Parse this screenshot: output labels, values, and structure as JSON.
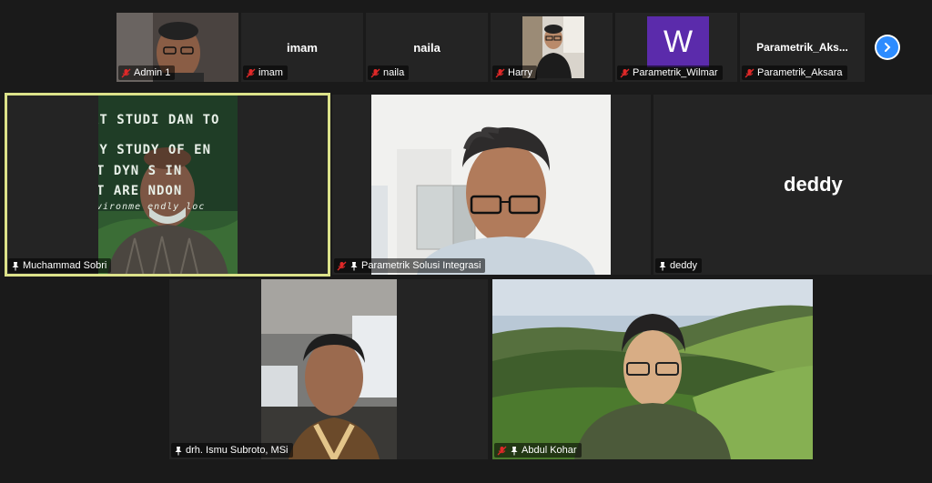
{
  "strip": {
    "tiles": [
      {
        "name": "Admin 1",
        "muted": true,
        "type": "video"
      },
      {
        "name": "imam",
        "muted": true,
        "type": "name",
        "display": "imam"
      },
      {
        "name": "naila",
        "muted": true,
        "type": "name",
        "display": "naila"
      },
      {
        "name": "Harry",
        "muted": true,
        "type": "video"
      },
      {
        "name": "Parametrik_Wilmar",
        "muted": true,
        "type": "avatar",
        "avatar_letter": "W",
        "avatar_color": "#5b2bab"
      },
      {
        "name": "Parametrik_Aksara",
        "muted": true,
        "type": "name",
        "display": "Parametrik_Aks..."
      }
    ]
  },
  "grid": {
    "tiles": [
      {
        "name": "Muchammad Sobri",
        "muted": false,
        "pinned": true,
        "active_speaker": true,
        "slide": {
          "line1": "AT STUDI DAN TO",
          "line2": "CY STUDY OF EN",
          "line3": "T DYN    S IN",
          "line4": "T ARE      NDON",
          "line5": "vironme     endly loc"
        }
      },
      {
        "name": "Parametrik Solusi Integrasi",
        "muted": true,
        "pinned": true
      },
      {
        "name": "deddy",
        "muted": false,
        "pinned": true,
        "display": "deddy"
      },
      {
        "name": "drh. Ismu Subroto, MSi",
        "muted": false,
        "pinned": true
      },
      {
        "name": "Abdul Kohar",
        "muted": true,
        "pinned": true
      }
    ]
  },
  "colors": {
    "active_border": "#dce28a",
    "muted_mic": "#e02828",
    "next_button": "#2d8cff"
  }
}
